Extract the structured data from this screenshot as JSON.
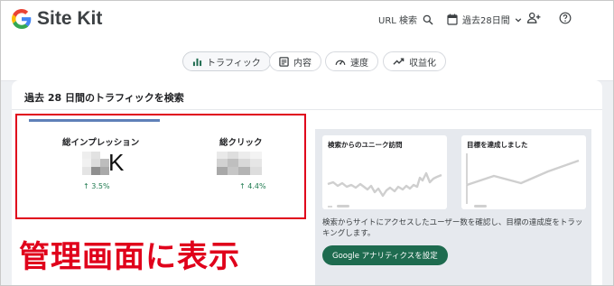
{
  "header": {
    "brand": "Site Kit",
    "url_search_label": "URL 検索",
    "date_range_label": "過去28日間",
    "icons": [
      "google-g-icon",
      "search-icon",
      "calendar-icon",
      "chevron-down-icon",
      "add-user-icon",
      "help-icon"
    ]
  },
  "nav": {
    "tabs": [
      {
        "label": "トラフィック",
        "icon": "bar-chart-icon",
        "active": true
      },
      {
        "label": "内容",
        "icon": "content-icon",
        "active": false
      },
      {
        "label": "速度",
        "icon": "speedometer-icon",
        "active": false
      },
      {
        "label": "収益化",
        "icon": "trend-up-icon",
        "active": false
      }
    ]
  },
  "card": {
    "title": "過去 28 日間のトラフィックを検索",
    "metrics": [
      {
        "label": "総インプレッション",
        "value_suffix": "K",
        "change": "↑ 3.5%"
      },
      {
        "label": "総クリック",
        "change": "↑ 4.4%"
      }
    ],
    "annotation": "管理画面に表示"
  },
  "analytics_panel": {
    "mini_charts": [
      {
        "title": "検索からのユニーク訪問"
      },
      {
        "title": "目標を達成しました"
      }
    ],
    "description": "検索からサイトにアクセスしたユーザー数を確認し、目標の達成度をトラッキングします。",
    "cta_label": "Google アナリティクスを設定"
  },
  "colors": {
    "accent_green": "#1e6b4f",
    "annotation_red": "#e0001b",
    "tab_indicator": "#5f80b8",
    "change_green": "#1e7a4f"
  }
}
